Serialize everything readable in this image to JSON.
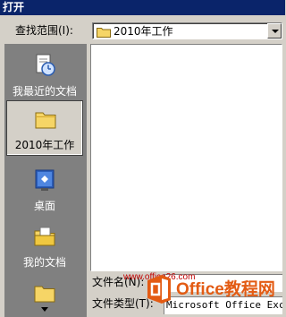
{
  "window": {
    "title": "打开"
  },
  "look_in": {
    "label": "查找范围(I):",
    "value": "2010年工作"
  },
  "places": [
    {
      "label": "我最近的文档",
      "icon": "recent-documents-icon",
      "selected": false
    },
    {
      "label": "2010年工作",
      "icon": "folder-icon",
      "selected": true
    },
    {
      "label": "桌面",
      "icon": "desktop-icon",
      "selected": false
    },
    {
      "label": "我的文档",
      "icon": "my-documents-icon",
      "selected": false
    },
    {
      "label": "",
      "icon": "folder-icon",
      "selected": false
    }
  ],
  "filename": {
    "label": "文件名(N):",
    "value": ""
  },
  "filetype": {
    "label": "文件类型(T):",
    "value": "Microsoft Office Excel"
  },
  "watermark": {
    "url": "www.office26.com",
    "brand": "Office教程网"
  },
  "colors": {
    "title_bg": "#0a246a",
    "dialog_bg": "#d4d0c8",
    "places_bg": "#808080",
    "brand": "#e35b13"
  }
}
